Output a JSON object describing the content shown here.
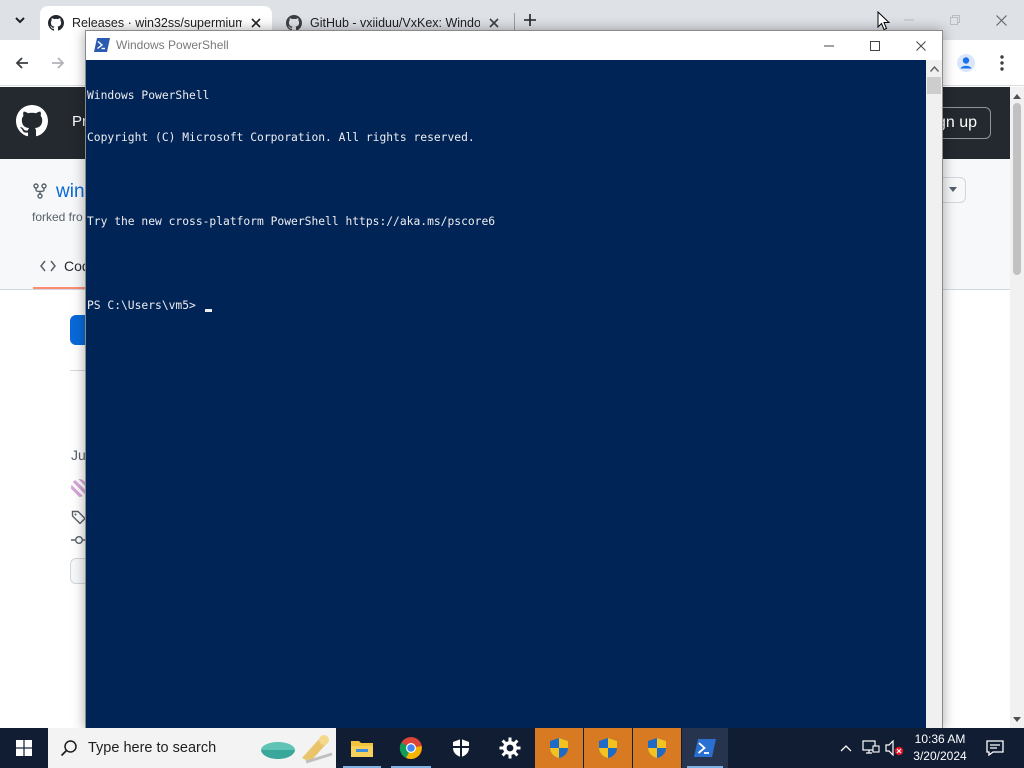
{
  "browser": {
    "tabs": [
      {
        "title": "Releases · win32ss/supermium",
        "active": true
      },
      {
        "title": "GitHub - vxiiduu/VxKex: Windo",
        "active": false
      }
    ],
    "new_tab_label": "+"
  },
  "github": {
    "product_label": "Pr",
    "signup_label": "gn up",
    "repo_name": "win",
    "forked_from": "forked fro",
    "code_tab_label": "Cod",
    "release_date": "Ju"
  },
  "powershell": {
    "window_title": "Windows PowerShell",
    "lines": [
      "Windows PowerShell",
      "Copyright (C) Microsoft Corporation. All rights reserved.",
      "",
      "Try the new cross-platform PowerShell https://aka.ms/pscore6",
      "",
      "PS C:\\Users\\vm5> "
    ]
  },
  "taskbar": {
    "search_placeholder": "Type here to search",
    "time": "10:36 AM",
    "date": "3/20/2024",
    "pinned": [
      "file-explorer",
      "chrome",
      "windows-security",
      "settings",
      "uac-shield",
      "uac-shield",
      "uac-shield",
      "powershell"
    ]
  },
  "colors": {
    "console_bg": "#012456",
    "console_fg": "#eeedf0",
    "github_header": "#24292f",
    "taskbar_bg": "#101d33",
    "taskbar_highlight": "#d87a21"
  }
}
